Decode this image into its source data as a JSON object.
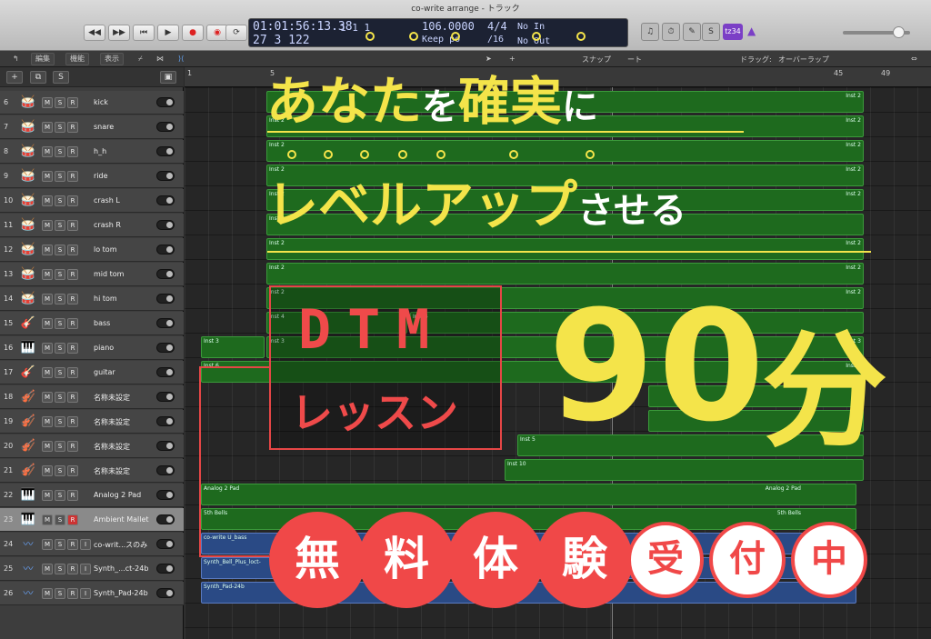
{
  "window": {
    "title": "co-write arrange - トラック"
  },
  "lcd": {
    "time1": "01:01:56:13.38",
    "time2": "27  3  122",
    "bars1": "1   1   1",
    "bars2": "",
    "tempo": "106.0000",
    "keep": "Keep   po",
    "sig": "4/4",
    "div": "/16",
    "no_in": "No In",
    "no_out": "No Out"
  },
  "toolbar": {
    "edit": "編集",
    "function": "機能",
    "view": "表示",
    "snap": "スナップ",
    "snap_val": "ート",
    "drag": "ドラッグ:",
    "drag_val": "オーバーラップ"
  },
  "badge": "tz34",
  "tracks": [
    {
      "num": "6",
      "name": "kick",
      "icon": "drum-icon"
    },
    {
      "num": "7",
      "name": "snare",
      "icon": "drum-icon"
    },
    {
      "num": "8",
      "name": "h_h",
      "icon": "drum-icon"
    },
    {
      "num": "9",
      "name": "ride",
      "icon": "drum-icon"
    },
    {
      "num": "10",
      "name": "crash L",
      "icon": "drum-icon"
    },
    {
      "num": "11",
      "name": "crash R",
      "icon": "drum-icon"
    },
    {
      "num": "12",
      "name": "lo tom",
      "icon": "drum-icon"
    },
    {
      "num": "13",
      "name": "mid tom",
      "icon": "drum-icon"
    },
    {
      "num": "14",
      "name": "hi tom",
      "icon": "drum-icon"
    },
    {
      "num": "15",
      "name": "bass",
      "icon": "bass-icon"
    },
    {
      "num": "16",
      "name": "piano",
      "icon": "piano-icon"
    },
    {
      "num": "17",
      "name": "guitar",
      "icon": "guitar-icon"
    },
    {
      "num": "18",
      "name": "名称未設定",
      "icon": "violin-icon"
    },
    {
      "num": "19",
      "name": "名称未設定",
      "icon": "violin-icon"
    },
    {
      "num": "20",
      "name": "名称未設定",
      "icon": "violin-icon"
    },
    {
      "num": "21",
      "name": "名称未設定",
      "icon": "violin-icon"
    },
    {
      "num": "22",
      "name": "Analog 2 Pad",
      "icon": "synth-icon"
    },
    {
      "num": "23",
      "name": "Ambient Mallet",
      "icon": "synth-icon"
    },
    {
      "num": "24",
      "name": "co-writ...スのみ",
      "icon": "waveform-icon"
    },
    {
      "num": "25",
      "name": "Synth_...ct-24b",
      "icon": "waveform-icon"
    },
    {
      "num": "26",
      "name": "Synth_Pad-24b",
      "icon": "waveform-icon"
    }
  ],
  "ruler": [
    "1",
    "5",
    "45",
    "49"
  ],
  "regions": {
    "inst2": "Inst 2",
    "inst3": "Inst 3",
    "inst4": "Inst 4",
    "inst5": "Inst 5",
    "inst6": "Inst 6",
    "inst10": "Inst 10",
    "analog": "Analog 2 Pad",
    "bells": "5th Bells",
    "bass_audio": "co-write U_bass",
    "bell_audio": "Synth_Bell_Plus_loct-",
    "pad_audio": "Synth_Pad-24b"
  },
  "overlay": {
    "line1_a": "あなた",
    "line1_b": "を",
    "line1_c": "確実",
    "line1_d": "に",
    "line2_a": "レベルアップ",
    "line2_b": "させる",
    "dtm": "DTM",
    "lesson": "レッスン",
    "ninety": "90",
    "fun": "分",
    "c1": "無",
    "c2": "料",
    "c3": "体",
    "c4": "験",
    "c5": "受",
    "c6": "付",
    "c7": "中"
  }
}
